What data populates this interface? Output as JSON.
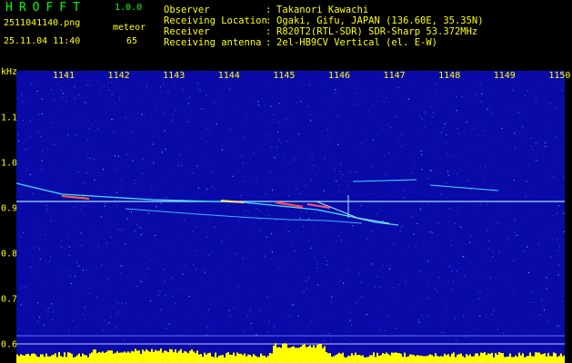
{
  "header": {
    "app_title": "HROFFT",
    "version": "1.0.0",
    "filename": "2511041140.png",
    "datetime": "25.11.04 11:40",
    "meteor_label": "meteor",
    "meteor_count": "65"
  },
  "info": [
    {
      "key": "Observer",
      "value": "Takanori Kawachi"
    },
    {
      "key": "Receiving Location",
      "value": "Ogaki, Gifu, JAPAN (136.60E, 35.35N)"
    },
    {
      "key": "Receiver",
      "value": "R820T2(RTL-SDR) SDR-Sharp 53.372MHz"
    },
    {
      "key": "Receiving antenna",
      "value": "2el-HB9CV Vertical (el. E-W)"
    }
  ],
  "axis": {
    "unit": "kHz",
    "x_ticks": [
      "1141",
      "1142",
      "1143",
      "1144",
      "1145",
      "1146",
      "1147",
      "1148",
      "1149",
      "1150"
    ],
    "y_ticks": [
      "1.1",
      "1.0",
      "0.9",
      "0.8",
      "0.7",
      "0.6"
    ]
  },
  "colors": {
    "background": "#000000",
    "spectrogram": "#0a0aa8",
    "axis_text": "#ffff00",
    "title_text": "#00ff00",
    "level_bar": "#ffff00",
    "echo_trace": "#40e0ff"
  }
}
